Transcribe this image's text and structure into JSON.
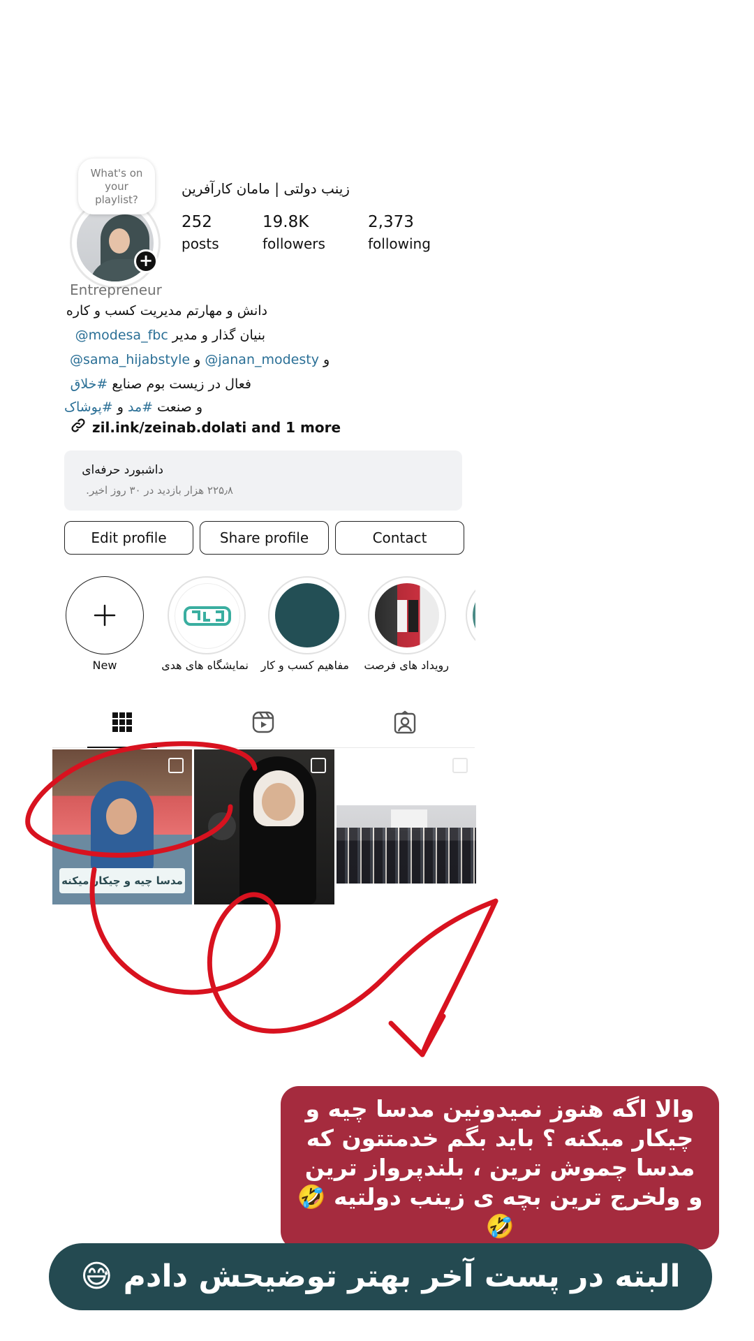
{
  "profile": {
    "note": "What's on your playlist?",
    "full_name": "زینب دولتی | مامان کارآفرین",
    "stats": {
      "posts_value": "252",
      "posts_label": "posts",
      "followers_value": "19.8K",
      "followers_label": "followers",
      "following_value": "2,373",
      "following_label": "following"
    },
    "category": "Entrepreneur",
    "bio": {
      "line1": "دانش و مهارتم مدیریت کسب و کاره",
      "line2_text": "بنیان گذار و مدیر ",
      "line2_mention": "@modesa_fbc",
      "line3_mention1": "@sama_hijabstyle",
      "line3_and1": " و ",
      "line3_mention2": "@janan_modesty",
      "line3_and2": " و",
      "line4_text": "فعال در زیست بوم صنایع ",
      "line4_tag": "#خلاق",
      "line5_text": "و صنعت ",
      "line5_tag1": "#مد",
      "line5_and": " و ",
      "line5_tag2": "#پوشاک"
    },
    "link": "zil.ink/zeinab.dolati and 1 more"
  },
  "dashboard": {
    "title": "داشبورد حرفه‌ای",
    "subtitle": "۲۲۵٫۸ هزار بازدید در ۳۰ روز اخیر."
  },
  "buttons": {
    "edit": "Edit profile",
    "share": "Share profile",
    "contact": "Contact"
  },
  "highlights": [
    {
      "label": "New"
    },
    {
      "label": "نمایشگاه های هدی"
    },
    {
      "label": "مفاهیم کسب و کار"
    },
    {
      "label": "رویداد های فرصت"
    }
  ],
  "posts": {
    "post1_overlay": "مدسا چیه و چیکار میکنه"
  },
  "overlay": {
    "red_caption": "والا اگه هنوز نمیدونین مدسا چیه و چیکار میکنه ؟ باید بگم خدمتتون که مدسا چموش ترین ، بلندپرواز ترین و ولخرج ترین بچه ی زینب دولتیه 🤣🤣",
    "teal_caption": "البته در پست آخر بهتر توضیحش دادم 😅"
  },
  "colors": {
    "mention": "#2a6f96",
    "red_caption_bg": "#a52b3e",
    "teal_caption_bg": "#244a51",
    "scribble": "#d8121f"
  }
}
